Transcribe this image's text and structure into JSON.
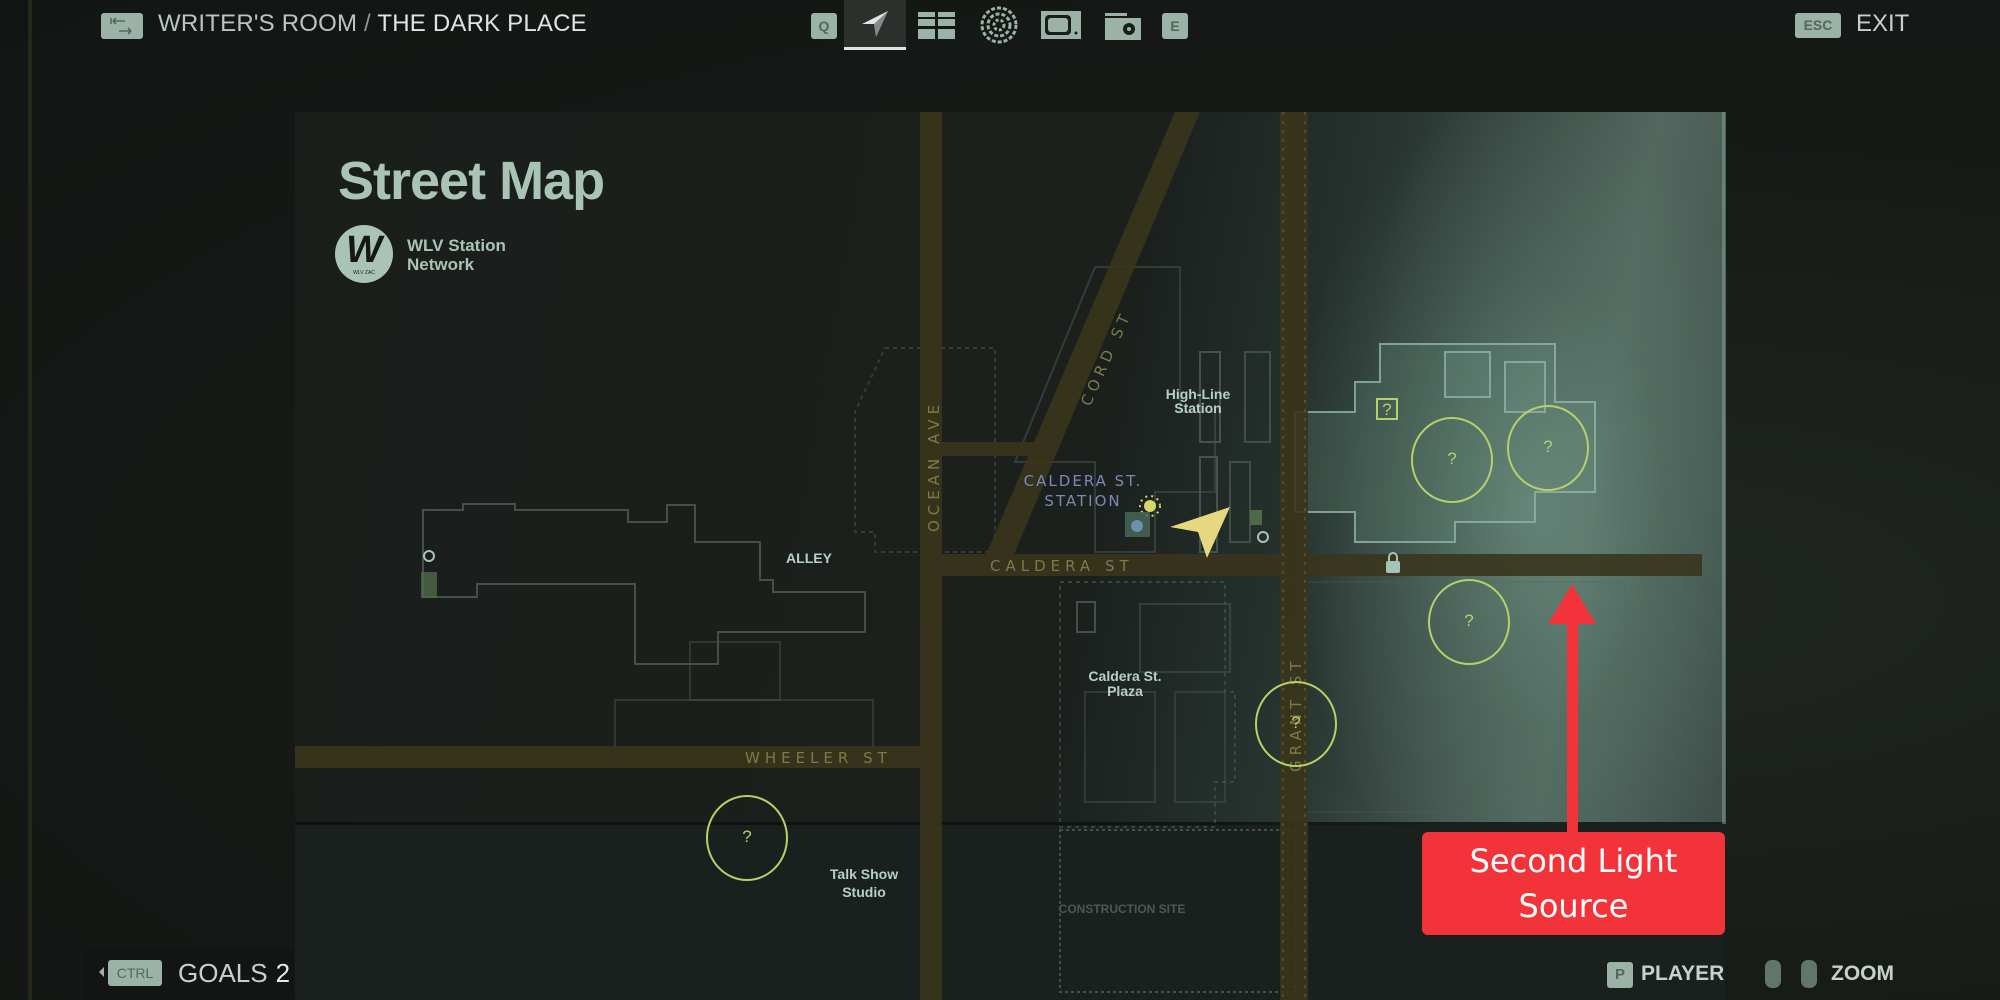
{
  "header": {
    "breadcrumb_parent": "WRITER'S ROOM",
    "breadcrumb_separator": "/",
    "breadcrumb_current": "THE DARK PLACE",
    "breadcrumb_key_icon": "swap-arrows-icon",
    "prev_tab_key": "Q",
    "next_tab_key": "E",
    "tabs": [
      {
        "icon": "map-navigation-icon",
        "active": true
      },
      {
        "icon": "case-board-icon",
        "active": false
      },
      {
        "icon": "fingerprint-swirl-icon",
        "active": false
      },
      {
        "icon": "television-icon",
        "active": false
      },
      {
        "icon": "radio-icon",
        "active": false
      }
    ],
    "exit_key": "ESC",
    "exit_label": "EXIT"
  },
  "footer": {
    "goals_key": "CTRL",
    "goals_label": "GOALS",
    "goals_count": "2",
    "player_key": "P",
    "player_label": "PLAYER",
    "zoom_label": "ZOOM"
  },
  "map": {
    "title": "Street Map",
    "logo_letter": "W",
    "logo_subtext": "WLV ZAC",
    "network_line1": "WLV Station",
    "network_line2": "Network",
    "streets": [
      "OCEAN AVE",
      "CORD ST",
      "CALDERA ST",
      "WHEELER ST",
      "GRANT ST"
    ],
    "places": {
      "caldera_station_1": "CALDERA ST.",
      "caldera_station_2": "STATION",
      "highline_1": "High-Line",
      "highline_2": "Station",
      "alley": "ALLEY",
      "plaza_1": "Caldera St.",
      "plaza_2": "Plaza",
      "talkshow_1": "Talk Show",
      "talkshow_2": "Studio",
      "construction": "CONSTRUCTION SITE"
    },
    "unknown_marker": "?",
    "accent_road_color": "#3a351c",
    "marker_color": "#b7d06a"
  },
  "annotation": {
    "line1": "Second Light",
    "line2": "Source",
    "color": "#f2343a"
  }
}
